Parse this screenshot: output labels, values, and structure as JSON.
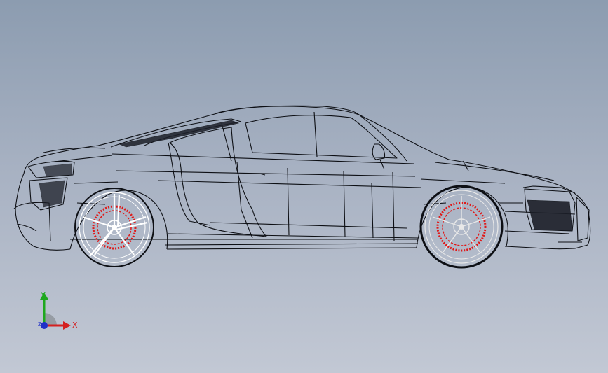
{
  "viewport": {
    "background_top": "#8c9cb0",
    "background_bottom": "#c2c8d4",
    "model_line_color": "#0d0f14",
    "brake_disc_color": "#e01818"
  },
  "triad": {
    "x_label": "X",
    "y_label": "Y",
    "z_label": "Z",
    "x_color": "#d42020",
    "y_color": "#1ea81e",
    "z_color": "#2030c8"
  }
}
